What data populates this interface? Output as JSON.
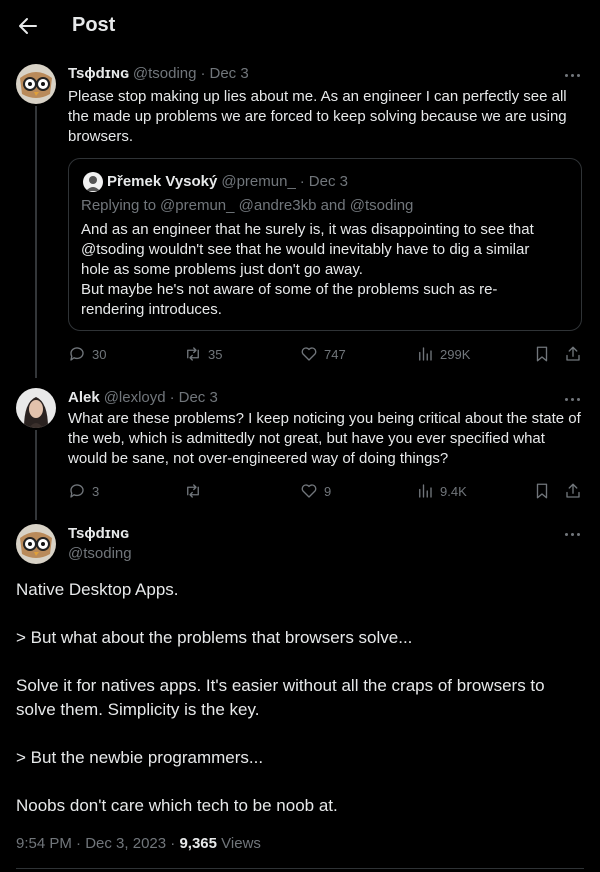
{
  "header": {
    "title": "Post"
  },
  "tweet1": {
    "name": "Tsɸdɪɴɢ",
    "handle": "@tsoding",
    "date": "Dec 3",
    "text": "Please stop making up lies about me. As an engineer I can perfectly see all the made up problems we are forced to keep solving because we are using browsers.",
    "quote": {
      "name": "Přemek Vysoký",
      "handle": "@premun_",
      "date": "Dec 3",
      "replying_prefix": "Replying to",
      "replying_to": "@premun_ @andre3kb and @tsoding",
      "text_line1": "And as an engineer that he surely is, it was disappointing to see that @tsoding wouldn't see that he would inevitably have to dig a similar hole as some problems just don't go away.",
      "text_line2": "But maybe he's not aware of some of the problems such as re-rendering introduces."
    },
    "replies": "30",
    "reposts": "35",
    "likes": "747",
    "views": "299K"
  },
  "tweet2": {
    "name": "Alek",
    "handle": "@lexloyd",
    "date": "Dec 3",
    "text": "What are these problems? I keep noticing you being critical about the state of the web, which is admittedly not great, but have you ever specified what would be sane, not over-engineered way of doing things?",
    "replies": "3",
    "reposts": "",
    "likes": "9",
    "views": "9.4K"
  },
  "main": {
    "name": "Tsɸdɪɴɢ",
    "handle": "@tsoding",
    "paragraphs": [
      "Native Desktop Apps.",
      "> But what about the problems that browsers solve...",
      "Solve it for natives apps. It's easier without all the craps of browsers to solve them. Simplicity is the key.",
      "> But the newbie programmers...",
      "Noobs don't care which tech to be noob at."
    ],
    "time": "9:54 PM",
    "date": "Dec 3, 2023",
    "views_count": "9,365",
    "views_label": "Views"
  },
  "separator": "·",
  "colors": {
    "background": "#000000",
    "text": "#e7e9ea",
    "muted": "#71767b",
    "border": "#2f3336"
  }
}
